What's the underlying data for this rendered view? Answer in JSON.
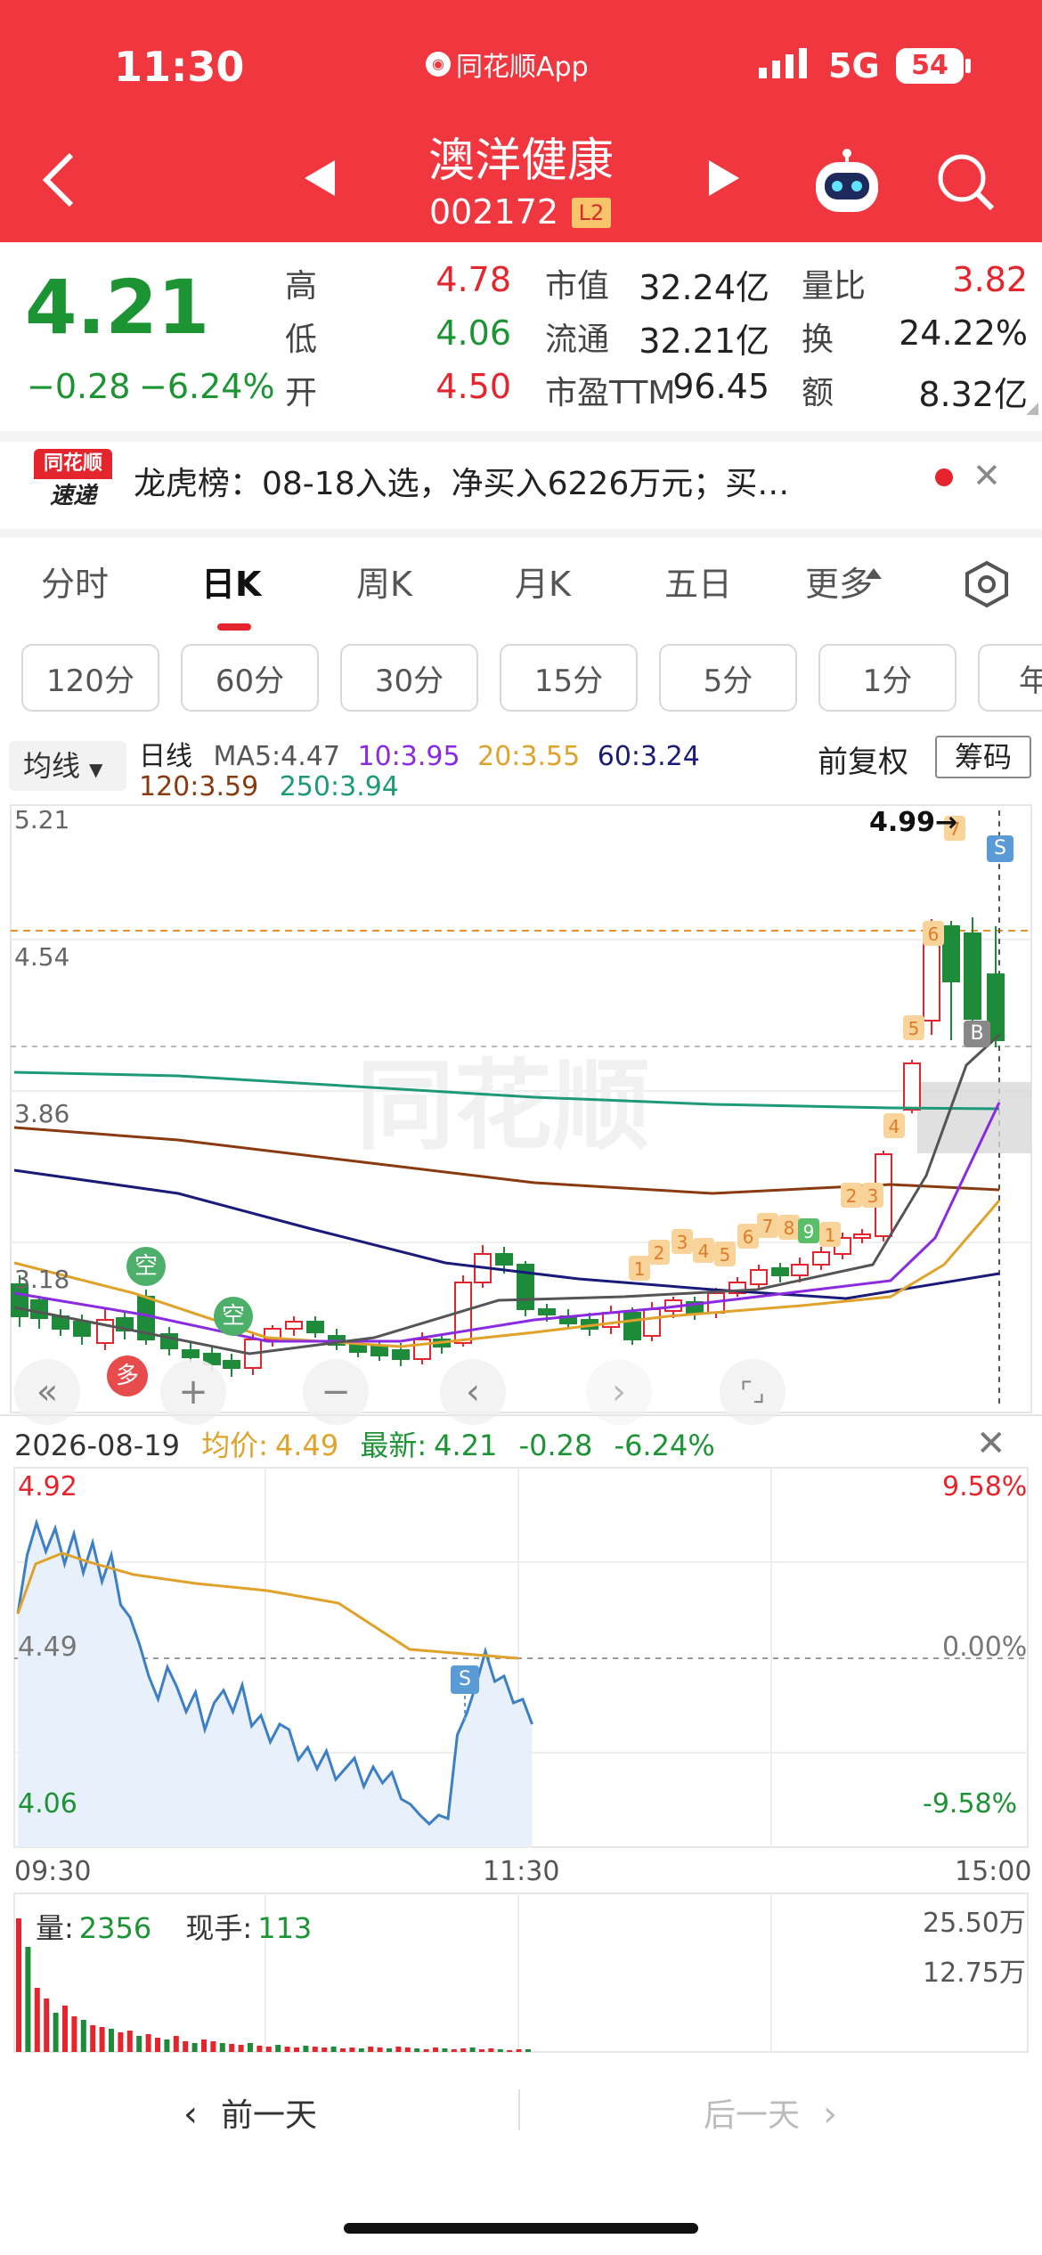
{
  "status": {
    "time": "11:30",
    "app": "同花顺App",
    "network": "5G",
    "battery": "54"
  },
  "header": {
    "stock_name": "澳洋健康",
    "stock_code": "002172",
    "level": "L2"
  },
  "quote": {
    "price": "4.21",
    "change": "−0.28",
    "change_pct": "−6.24%",
    "stats": [
      {
        "label": "高",
        "value": "4.78",
        "c": "red"
      },
      {
        "label": "市值",
        "value": "32.24亿",
        "c": "dark"
      },
      {
        "label": "量比",
        "value": "3.82",
        "c": "red"
      },
      {
        "label": "低",
        "value": "4.06",
        "c": "green"
      },
      {
        "label": "流通",
        "value": "32.21亿",
        "c": "dark"
      },
      {
        "label": "换",
        "value": "24.22%",
        "c": "dark"
      },
      {
        "label": "开",
        "value": "4.50",
        "c": "red"
      },
      {
        "label": "市盈TTM",
        "value": "96.45",
        "c": "dark"
      },
      {
        "label": "额",
        "value": "8.32亿",
        "c": "dark"
      }
    ]
  },
  "news": {
    "logo_top": "同花顺",
    "logo_bottom": "速递",
    "text": "龙虎榜：08-18入选，净买入6226万元；买…"
  },
  "tabs": [
    "分时",
    "日K",
    "周K",
    "月K",
    "五日",
    "更多"
  ],
  "active_tab": "日K",
  "periods": [
    "120分",
    "60分",
    "30分",
    "15分",
    "5分",
    "1分",
    "年"
  ],
  "kline": {
    "indicator": "均线",
    "line_label": "日线",
    "ma5": "MA5:4.47",
    "ma10": "10:3.95",
    "ma20": "20:3.55",
    "ma60": "60:3.24",
    "ma120": "120:3.59",
    "ma250": "250:3.94",
    "adjust": "前复权",
    "chip": "筹码",
    "y_labels": [
      "5.21",
      "4.54",
      "3.86",
      "3.18"
    ],
    "high_mark": "4.99→",
    "badges": {
      "empty": "空",
      "more": "多",
      "sell": "S",
      "buy": "B"
    },
    "counts": [
      "1",
      "2",
      "3",
      "4",
      "5",
      "6",
      "7",
      "8",
      "9",
      "1",
      "2",
      "3",
      "4",
      "5",
      "6",
      "7"
    ],
    "colors": {
      "ma5": "#555555",
      "ma10": "#8a2be2",
      "ma20": "#e0a22a",
      "ma60": "#1a1a7a",
      "ma120": "#8b3a0f",
      "ma250": "#1e9a78"
    }
  },
  "intraday": {
    "date": "2026-08-19",
    "avg_label": "均价:",
    "avg": "4.49",
    "latest_label": "最新:",
    "latest": "4.21",
    "chg": "-0.28",
    "chg_pct": "-6.24%",
    "y_top": "4.92",
    "y_mid": "4.49",
    "y_bot": "4.06",
    "pct_top": "9.58%",
    "pct_mid": "0.00%",
    "pct_bot": "-9.58%",
    "t_start": "09:30",
    "t_mid": "11:30",
    "t_end": "15:00",
    "vol_label": "量:",
    "vol": "2356",
    "hand_label": "现手:",
    "hand": "113",
    "vol_top": "25.50万",
    "vol_mid": "12.75万"
  },
  "footer": {
    "prev": "前一天",
    "next": "后一天"
  }
}
